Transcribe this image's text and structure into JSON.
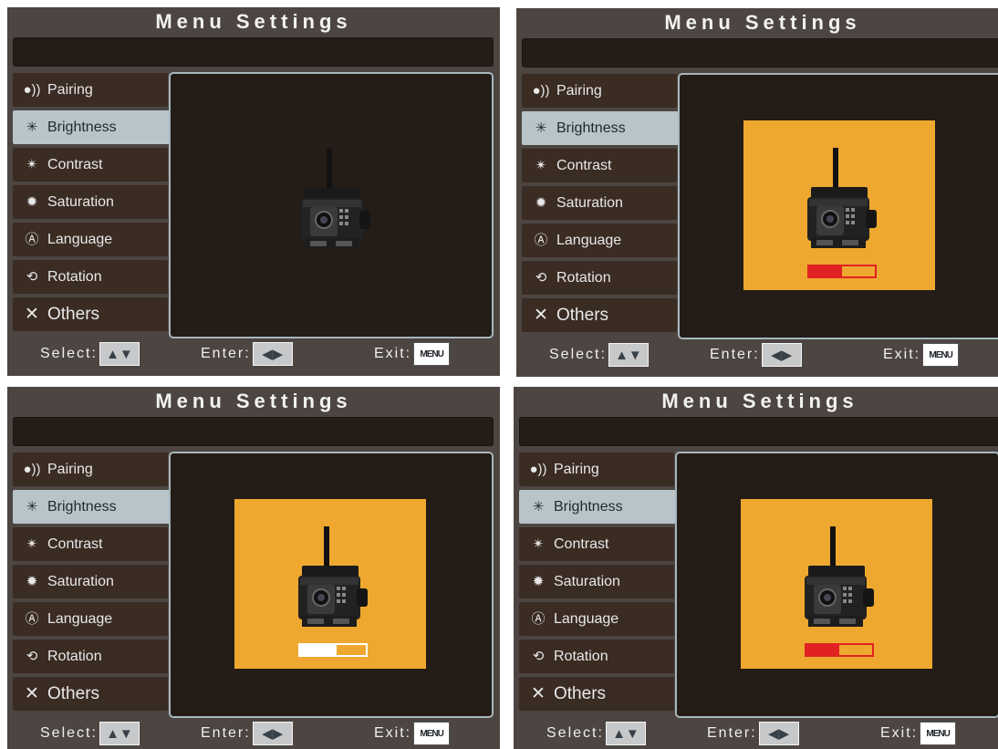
{
  "menu_title": "Menu Settings",
  "menu_items": [
    {
      "icon": "pairing-icon",
      "label": "Pairing"
    },
    {
      "icon": "brightness-icon",
      "label": "Brightness"
    },
    {
      "icon": "contrast-icon",
      "label": "Contrast"
    },
    {
      "icon": "saturation-icon",
      "label": "Saturation"
    },
    {
      "icon": "language-icon",
      "label": "Language"
    },
    {
      "icon": "rotation-icon",
      "label": "Rotation"
    },
    {
      "icon": "others-icon",
      "label": "Others"
    }
  ],
  "footer": {
    "select_label": "Select:",
    "enter_label": "Enter:",
    "exit_label": "Exit:",
    "menu_key": "MENU"
  },
  "panels": [
    {
      "selected": "Brightness",
      "adjust_mode": false
    },
    {
      "selected": "Brightness",
      "adjust_mode": true,
      "level_fraction": 0.5,
      "level_color": "#e02222"
    },
    {
      "selected": "Brightness",
      "adjust_mode": true,
      "level_fraction": 0.55,
      "level_color": "#ffffff"
    },
    {
      "selected": "Brightness",
      "adjust_mode": true,
      "level_fraction": 0.5,
      "level_color": "#e02222"
    }
  ],
  "colors": {
    "panel_bg": "#4c4541",
    "menu_item_bg": "#3a2b23",
    "selected_bg": "#b8c4c8",
    "preview_bg": "#241c17",
    "adjust_bg": "#efa82f"
  }
}
